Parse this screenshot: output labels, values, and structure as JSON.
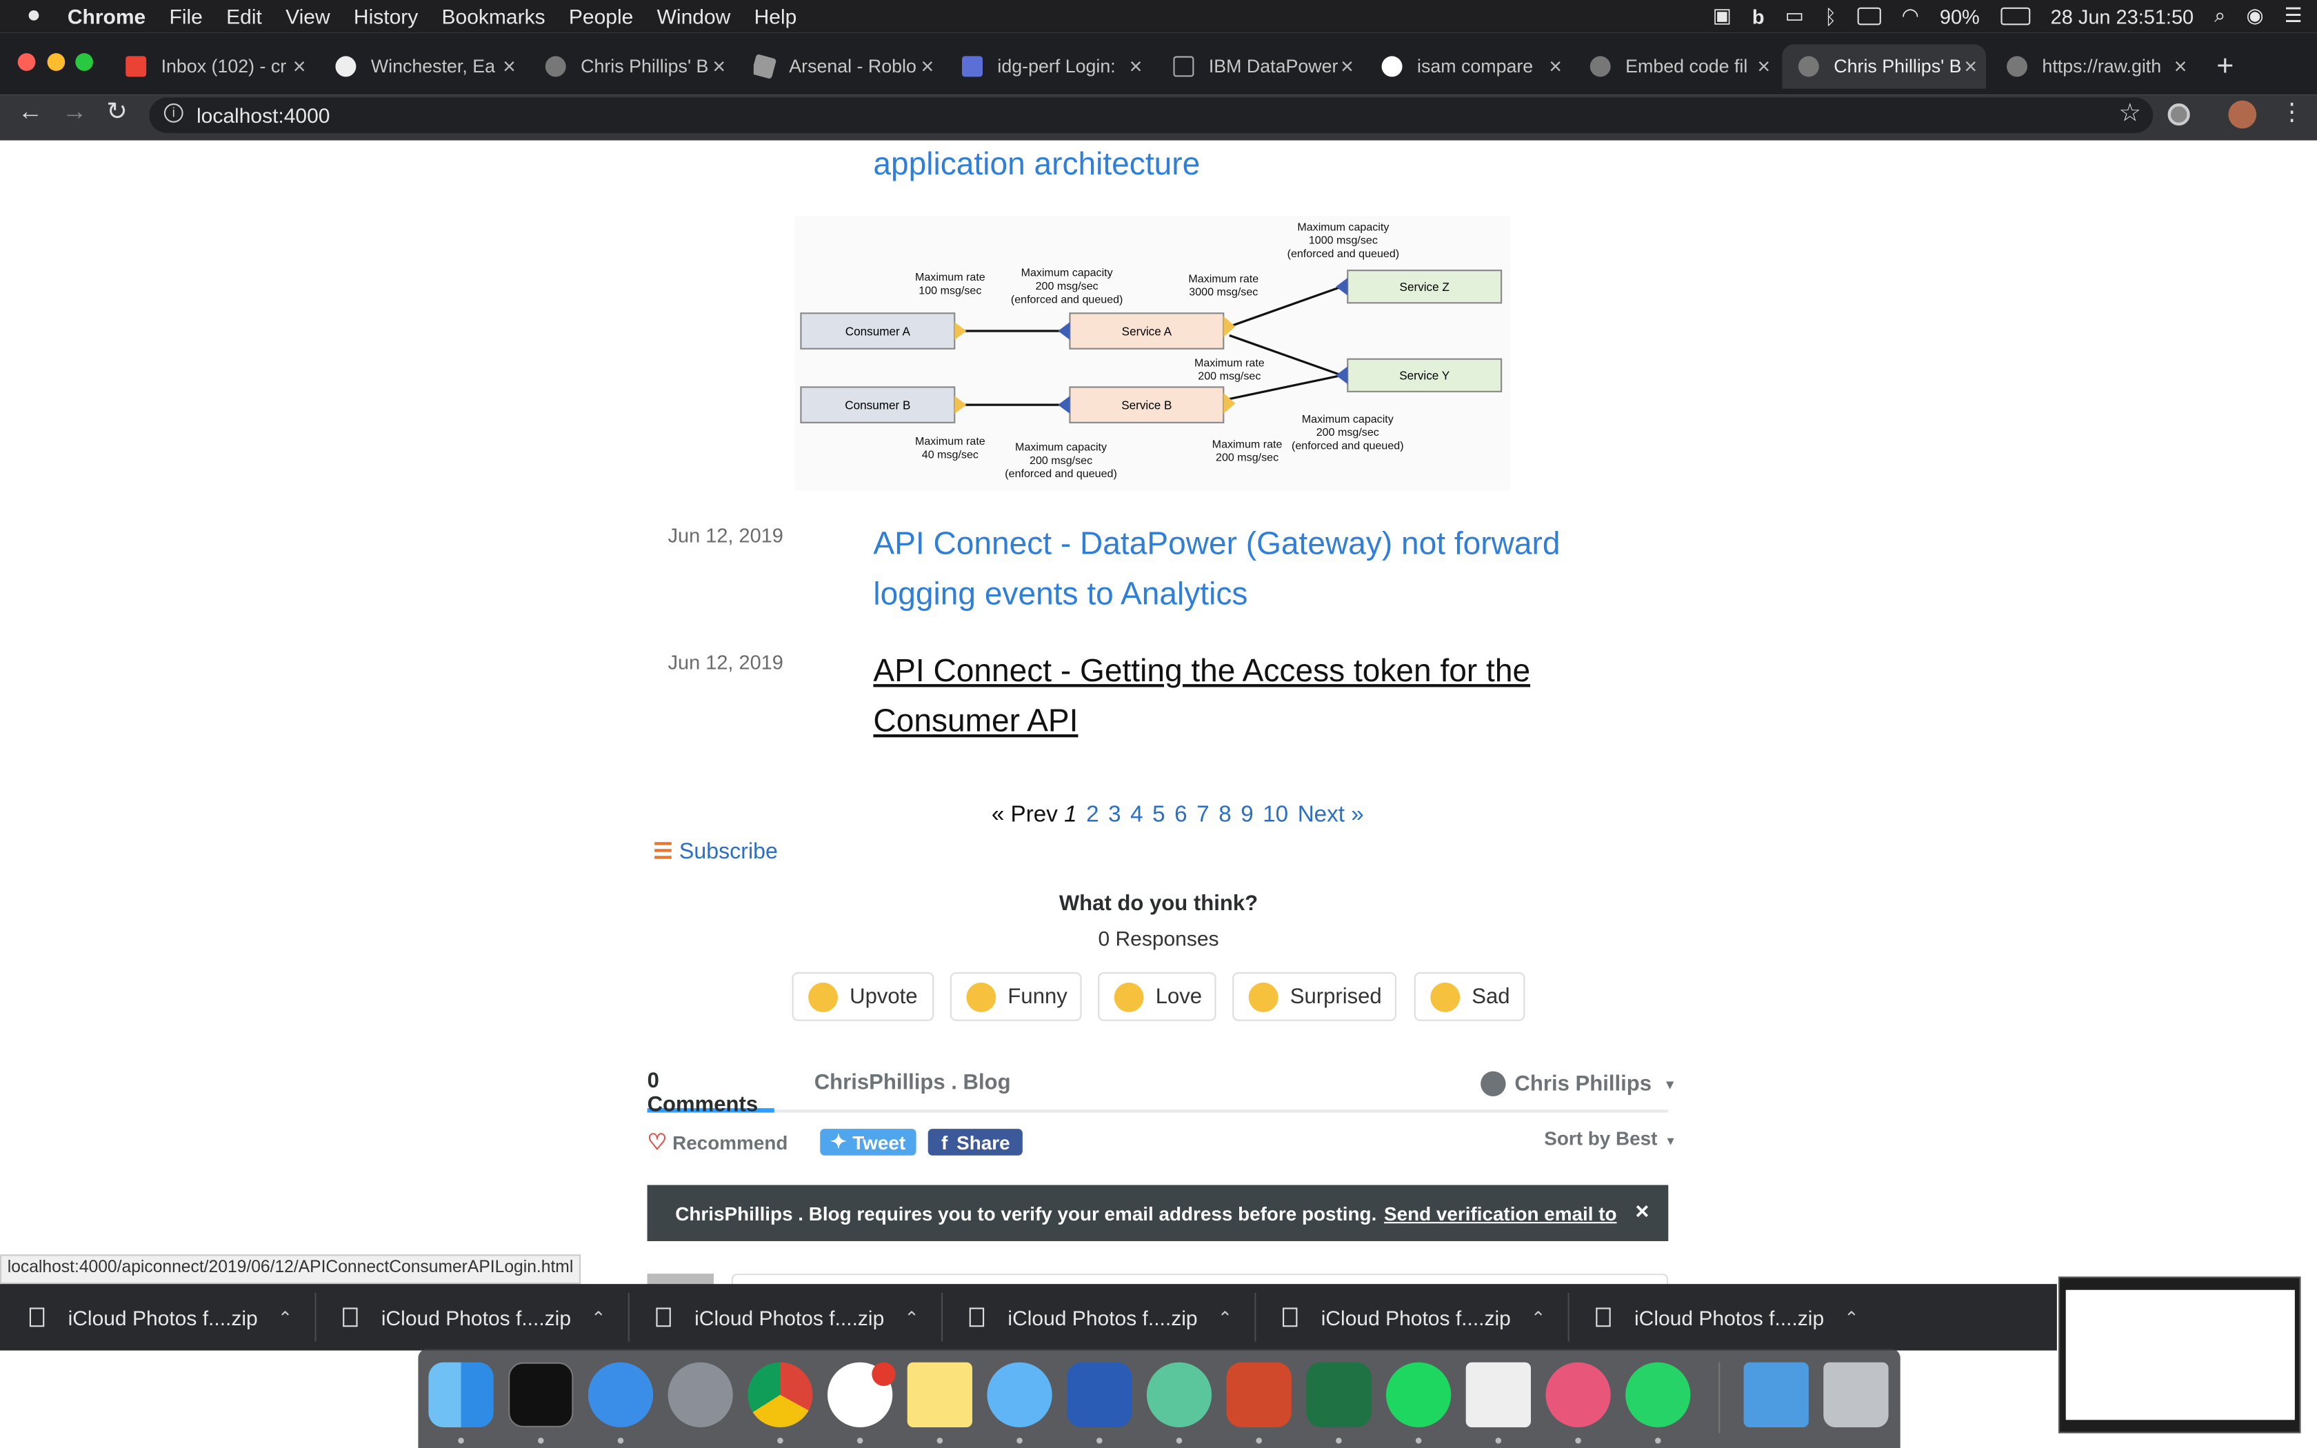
{
  "menubar": {
    "app": "Chrome",
    "items": [
      "File",
      "Edit",
      "View",
      "History",
      "Bookmarks",
      "People",
      "Window",
      "Help"
    ],
    "battery": "90%",
    "clock": "28 Jun  23:51:50"
  },
  "tabs": [
    {
      "title": "Inbox (102) - cr",
      "icon": "gmail-icon"
    },
    {
      "title": "Winchester, Ea",
      "icon": "globe-icon"
    },
    {
      "title": "Chris Phillips' B",
      "icon": "globe-icon"
    },
    {
      "title": "Arsenal - Roblo",
      "icon": "roblox-icon"
    },
    {
      "title": "idg-perf Login:",
      "icon": "grid-icon"
    },
    {
      "title": "IBM DataPower",
      "icon": "box-icon"
    },
    {
      "title": "isam compare",
      "icon": "google-icon"
    },
    {
      "title": "Embed code fil",
      "icon": "globe-icon"
    },
    {
      "title": "Chris Phillips' B",
      "icon": "globe-icon"
    },
    {
      "title": "https://raw.gith",
      "icon": "globe-icon"
    }
  ],
  "toolbar": {
    "url": "localhost:4000"
  },
  "content": {
    "top_link": "application architecture",
    "diagram": {
      "consumer_a": "Consumer A",
      "consumer_b": "Consumer B",
      "service_a": "Service A",
      "service_b": "Service B",
      "service_z": "Service Z",
      "service_y": "Service Y",
      "rate_a": [
        "Maximum rate",
        "100 msg/sec"
      ],
      "cap_a": [
        "Maximum capacity",
        "200 msg/sec",
        "(enforced and queued)"
      ],
      "rate_z": [
        "Maximum rate",
        "3000 msg/sec"
      ],
      "cap_z": [
        "Maximum capacity",
        "1000 msg/sec",
        "(enforced and queued)"
      ],
      "rate_y": [
        "Maximum rate",
        "200 msg/sec"
      ],
      "rate_b": [
        "Maximum rate",
        "40 msg/sec"
      ],
      "cap_b": [
        "Maximum capacity",
        "200 msg/sec",
        "(enforced and queued)"
      ],
      "rate_by": [
        "Maximum rate",
        "200 msg/sec"
      ],
      "cap_y": [
        "Maximum capacity",
        "200 msg/sec",
        "(enforced and queued)"
      ]
    },
    "posts": [
      {
        "date": "Jun 12, 2019",
        "title_line1": "API Connect - DataPower (Gateway) not forward",
        "title_line2": "logging events to Analytics"
      },
      {
        "date": "Jun 12, 2019",
        "title_line1": "API Connect - Getting the Access token for the",
        "title_line2": "Consumer API"
      }
    ],
    "pagination": {
      "prev": "« Prev",
      "current": "1",
      "pages": [
        "2",
        "3",
        "4",
        "5",
        "6",
        "7",
        "8",
        "9",
        "10"
      ],
      "next": "Next »"
    },
    "subscribe": "Subscribe"
  },
  "reactions": {
    "question": "What do you think?",
    "responses": "0 Responses",
    "buttons": [
      "Upvote",
      "Funny",
      "Love",
      "Surprised",
      "Sad"
    ]
  },
  "disqus": {
    "comments_tab": "0 Comments",
    "community_tab": "ChrisPhillips . Blog",
    "user": "Chris Phillips",
    "recommend": "Recommend",
    "tweet": "Tweet",
    "share": "Share",
    "sort": "Sort by Best",
    "verify_text": "ChrisPhillips . Blog requires you to verify your email address before posting.",
    "verify_link": "Send verification email to"
  },
  "status_url": "localhost:4000/apiconnect/2019/06/12/APIConnectConsumerAPILogin.html",
  "downloads": [
    "iCloud Photos f....zip",
    "iCloud Photos f....zip",
    "iCloud Photos f....zip",
    "iCloud Photos f....zip",
    "iCloud Photos f....zip",
    "iCloud Photos f....zip"
  ],
  "dock": [
    "Finder",
    "Terminal",
    "Safari",
    "Launchpad",
    "Chrome",
    "Slack",
    "Notes",
    "Messages",
    "Word",
    "Atom",
    "PowerPoint",
    "Excel",
    "Spotify",
    "TextEdit",
    "iTunes",
    "WhatsApp",
    "Folder",
    "Trash"
  ],
  "colors": {
    "link": "#2d7bd8",
    "menubar": "#1f1f21",
    "tabbar": "#1e1f22",
    "banner": "#3d4549"
  }
}
